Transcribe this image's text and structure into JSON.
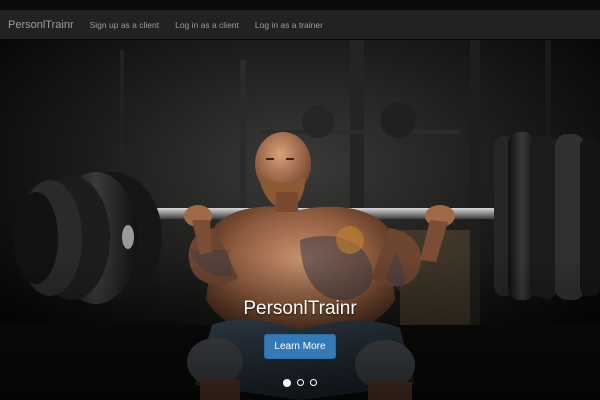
{
  "navbar": {
    "brand": "PersonlTrainr",
    "links": [
      {
        "label": "Sign up as a client"
      },
      {
        "label": "Log in as a client"
      },
      {
        "label": "Log in as a trainer"
      }
    ]
  },
  "hero": {
    "title": "PersonlTrainr",
    "button_label": "Learn More",
    "slide_count": 3,
    "active_slide": 1,
    "colors": {
      "button": "#337ab7",
      "navbar": "#222222",
      "nav_text": "#9d9d9d"
    }
  }
}
